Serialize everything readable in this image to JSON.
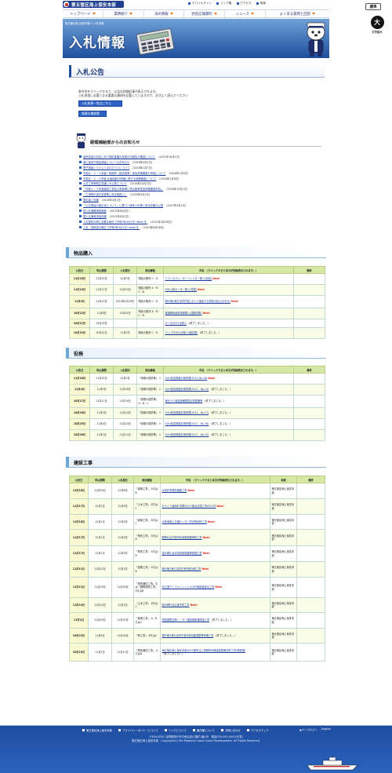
{
  "header": {
    "logo_text": "第五管区海上保安本部",
    "util": [
      {
        "label": "モバイルサイト",
        "icon": "mobile-icon"
      },
      {
        "label": "リンク集",
        "icon": "link-icon"
      },
      {
        "label": "アクセス",
        "icon": "map-icon"
      },
      {
        "label": "検索",
        "icon": "search-icon"
      }
    ],
    "nav": [
      {
        "label": "トップページ"
      },
      {
        "label": "業務紹介"
      },
      {
        "label": "海の情報"
      },
      {
        "label": "防犯広報資料"
      },
      {
        "label": "ニュース"
      },
      {
        "label": "よくある質問と回答"
      }
    ],
    "hyojun_label": "標準",
    "moji_char": "大",
    "moji_label": "文字拡大"
  },
  "banner": {
    "breadcrumb": "第五管区海上保安本部 > 入札情報",
    "title": "入札情報"
  },
  "page": {
    "title": "入札公告",
    "intro_line1": "各件名をクリックすると、公告の詳細記事が表示されます。",
    "intro_line2": "入札参加に必要となる重要な事項を記載していますので、必ずよく読んでください",
    "btn_list": "入札結果一覧はこちら",
    "btn_gyosha": "調達仕様書類"
  },
  "info": {
    "title": "経理補給部からのお知らせ",
    "items": [
      {
        "text": "最低賃金の改定に伴う契約金額の変更の可能性の確認について",
        "date": "（2021年10月1日）"
      },
      {
        "text": "海上保安庁物品調達についてのお知らせ",
        "date": "（2020年4月1日）"
      },
      {
        "text": "電子調達システムへのログインについて",
        "date": "（2016年1月1日）"
      },
      {
        "text": "令和元・２・３年度一般競争（指名競争）参加資格審査の申請について",
        "date": "（2018年1月9日）"
      },
      {
        "text": "令和元・２・３年度 区画船舶の修繕に関する資格審査について",
        "date": "（2018年1月9日）"
      },
      {
        "text": "公共工事等発注見通しの公表について",
        "date": "（2018年10月1日）"
      },
      {
        "text": "「令和２・３年度建設工事及び測量等に係る競争参加資格審査申請」",
        "date": "（2018年10月1日）"
      },
      {
        "text": "「工事等の設計変更等に係る取扱い」",
        "date": "（2018年4月1日）"
      },
      {
        "text": "落札者と情報",
        "date": "（2016年4月1日）"
      },
      {
        "text": "「公共調達の適正化について」に基づく競争入札等に係る情報の公表",
        "date": "（2017年4月1日）"
      },
      {
        "text": "低入札価格調査制度",
        "date": "（2015年8月4日）"
      },
      {
        "text": "国土交通省調達情報",
        "date": "（2015年4月1日）"
      },
      {
        "text": "入札契約の際に必要な様式【令和3年4月1日～New!!】",
        "date": "（2021年4月28日）"
      },
      {
        "text": "入札・見積書の様式【令和3年4月1日～New!!】",
        "date": "（2014年8月28日）"
      }
    ]
  },
  "sections": {
    "goods": {
      "title": "物品購入",
      "headers": [
        "公告日",
        "申込期限",
        "入札期日",
        "参加資格",
        "件名　（クリックすると本文が別画表示されます。）",
        "備考"
      ],
      "rows": [
        {
          "date": "11月16日",
          "deadline": "11月25日",
          "bid": "12月3日",
          "qual": "物品の販売 C・D",
          "title": "ミストセパレーターフィルター購入(船用)",
          "new": "New!",
          "note": ""
        },
        {
          "date": "11月10日",
          "deadline": "11月17日",
          "bid": "11月25日",
          "qual": "物品の販売 A・B・C・D",
          "title": "SSR-4用セーター購入(境港)",
          "new": "New!",
          "note": ""
        },
        {
          "date": "11月4日",
          "deadline": "11月13日",
          "bid": "2022年1月19日",
          "qual": "物品の販売 C・D",
          "title": "神戸第2海方合同庁舎において使用する電気(高圧)(お手分)",
          "new": "New!",
          "note": ""
        },
        {
          "date": "10月22日",
          "deadline": "11月8日",
          "bid": "11月24日",
          "qual": "物品の販売 A・B・C・D",
          "title": "普通車両用乾電車購入(国際列車)",
          "new": "New!",
          "note": ""
        },
        {
          "date": "10月12日",
          "deadline": "10月18日",
          "bid": "",
          "qual": "",
          "title": "ガーゼほか7点購入",
          "new": "（終了しました。）",
          "note": ""
        },
        {
          "date": "10月19日",
          "deadline": "10月22日",
          "bid": "11月3日",
          "qual": "物品の販売 C・D",
          "title": "ラップほか22点購入(増高課)",
          "new": "（終了しました。）",
          "note": ""
        }
      ]
    },
    "services": {
      "title": "役務",
      "headers": [
        "公告日",
        "申込期限",
        "入札期日",
        "参加資格",
        "件名　（クリックすると本文が別画表示されます。）",
        "備考"
      ],
      "rows": [
        {
          "date": "11月16日",
          "deadline": "11月25日",
          "bid": "12月3日",
          "qual": "「役務の提供等」 C",
          "title": "20m型巡視艇中検修理(2021-No.18)",
          "new": "New!",
          "note": ""
        },
        {
          "date": "11月4日",
          "deadline": "11月9日",
          "bid": "11月18日",
          "qual": "「役務の提供等」 C",
          "title": "20m型巡視艇定検修理(2021 - No.14)",
          "new": "（終了しました。）",
          "note": ""
        },
        {
          "date": "10月27日",
          "deadline": "11月11日",
          "bid": "11月19日",
          "qual": "「役務の提供等」 A・B・C",
          "title": "第五ガス製造設備整理点検整備等",
          "new": "（終了しました。）",
          "note": ""
        },
        {
          "date": "10月26日",
          "deadline": "11月3日",
          "bid": "11月10日",
          "qual": "「役務の提供等」 C",
          "title": "20m型巡視艇定検修理(2021 - No.17)",
          "new": "（終了しました。）",
          "note": ""
        },
        {
          "date": "10月25日",
          "deadline": "11月4日",
          "bid": "11月10日",
          "qual": "「役務の提供等」 C",
          "title": "20m型巡視艇定検修理(2021 - No.16)",
          "new": "（終了しました。）",
          "note": ""
        },
        {
          "date": "10月28日",
          "deadline": "11月2日",
          "bid": "11月11日",
          "qual": "「役務の提供等」 C",
          "title": "20m型巡視艇定検修理(2021 - No.15)",
          "new": "（終了しました。）",
          "note": ""
        }
      ]
    },
    "construction": {
      "title": "建設工事",
      "headers": [
        "公告日",
        "申込期限",
        "入札期日",
        "参加資格",
        "件名　（クリックすると本文が別画表示されます。）",
        "地域",
        "備考"
      ],
      "rows": [
        {
          "date": "11月18日",
          "deadline": "11月29日",
          "bid": "12月6日",
          "qual": "「建築工事」 A又はB",
          "title": "大佐町事務所通路工事",
          "new": "New!",
          "area": "第五管区海上保安本部",
          "note": ""
        },
        {
          "date": "11月17日",
          "deadline": "12月1日",
          "bid": "12月9日",
          "qual": "「土木工事」 B又はC",
          "title": "セメント袖岡灯浮標ほか５基余交換工事ほか1件",
          "new": "New!",
          "area": "第五管区海上保安本部",
          "note": ""
        },
        {
          "date": "11月16日",
          "deadline": "12月1日",
          "bid": "12月9日",
          "qual": "「建築工事」 B又はC",
          "title": "大阪海港上交通センター同光等改修工事",
          "new": "New!",
          "area": "第五管区海上保安本部",
          "note": ""
        },
        {
          "date": "11月17日",
          "deadline": "12月1日",
          "bid": "12月9日",
          "qual": "「電気工事」 A又はB",
          "title": "勝神灯台付属所有用発電機等修工事",
          "new": "New!",
          "area": "第五管区海上保安本部",
          "note": ""
        },
        {
          "date": "11月17日",
          "deadline": "12月1日",
          "bid": "12月9日",
          "qual": "「電気工事」 A又はB",
          "title": "室戸岬灯台非常用発電機等修理工事",
          "new": "New!",
          "area": "第五管区海上保安本部",
          "note": ""
        },
        {
          "date": "11月11日",
          "deadline": "11月22日",
          "bid": "12月3日",
          "qual": "「建築工事」 A又はB",
          "title": "神戸第2海方合同庁舎外壁改修工事",
          "new": "New!",
          "area": "第五管区海上保安本部",
          "note": ""
        },
        {
          "date": "11月11日",
          "deadline": "11月19日",
          "bid": "11月26日",
          "qual": "「電気通信工事」又は「鋼構造物工事」A又はB",
          "title": "浜江港ディファレンシャルGPS局設置進出工事",
          "new": "New!",
          "area": "第五管区海上保安本部",
          "note": ""
        },
        {
          "date": "11月10日",
          "deadline": "11月25日",
          "bid": "12月3日",
          "qual": "「土木工事」 B又はC",
          "title": "室戸岬灯台災害予防工事",
          "new": "New!",
          "area": "第五管区海上保安本部",
          "note": ""
        },
        {
          "date": "11月1日",
          "deadline": "11月16日",
          "bid": "11月25日",
          "qual": "「建築工事」 A、B又はC",
          "title": "関西国際空港レーダー施設構築漏修繕工事",
          "new": "（終了しました。）",
          "area": "第五管区海上保安本部",
          "note": ""
        },
        {
          "date": "10月22日",
          "deadline": "11月9日",
          "bid": "11月16日",
          "qual": "「電工事」 B又はC",
          "title": "神戸第2海方合同庁舎外部自動調整等修理工事",
          "new": "（終了しました。）",
          "area": "第五管区海上保安本部",
          "note": ""
        },
        {
          "date": "10月19日",
          "deadline": "11月2日",
          "bid": "11月11日",
          "qual": "「電気通信工事」 A又はB",
          "title": "第五管区海上保安本部ほか1箇所注上港務所情報装置整備改修工事(埋港課)",
          "new": "（終了しました。）",
          "area": "第五管区海上保安本部",
          "note": ""
        }
      ]
    }
  },
  "footer": {
    "links": [
      {
        "label": "第五管区海上保安本部"
      },
      {
        "label": "プライバシーポリシーについて"
      },
      {
        "label": "リンクについて"
      },
      {
        "label": "著作権について"
      },
      {
        "label": "お問い合わせ"
      },
      {
        "label": "アクセスマップ"
      }
    ],
    "pagetop": "▲ページの上へ",
    "lang": "English",
    "addr": "〒650-8551 兵庫県神戸市中央区波止場町1番1号　電話078-391-6551(代表)",
    "copyright": "第五管区海上保安本部　Copyright(C) 5th Regional Coast Guard Headquarters. All Rights Reserved."
  }
}
